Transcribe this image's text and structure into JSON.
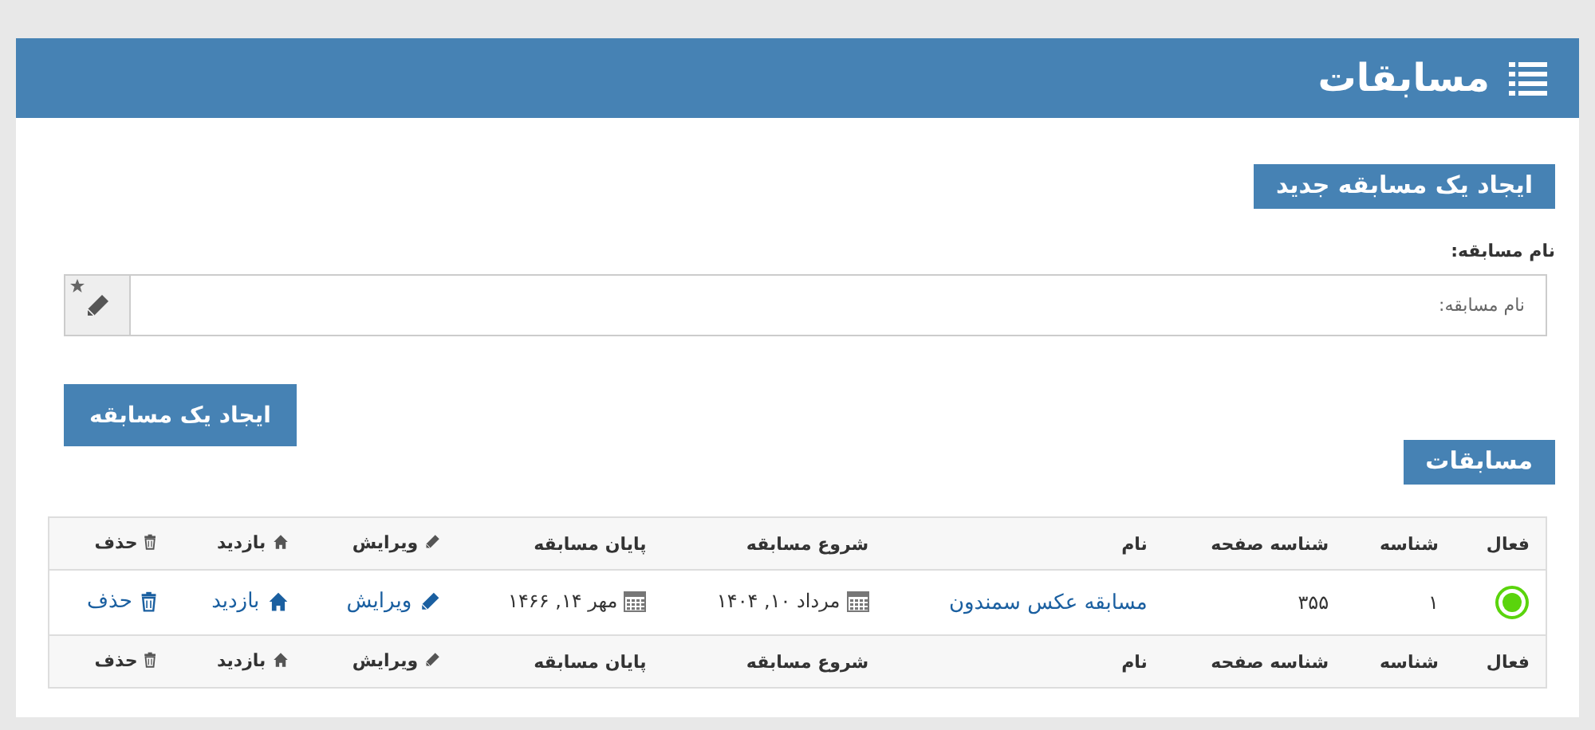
{
  "header": {
    "title": "مسابقات"
  },
  "create_section": {
    "heading": "ایجاد یک مسابقه جدید",
    "field": {
      "label": "نام مسابقه:",
      "placeholder": "نام مسابقه:"
    },
    "button": "ایجاد یک مسابقه"
  },
  "list_section": {
    "heading": "مسابقات",
    "table": {
      "columns": [
        {
          "label": "فعال",
          "kind": "plain"
        },
        {
          "label": "شناسه",
          "kind": "plain"
        },
        {
          "label": "شناسه صفحه",
          "kind": "plain"
        },
        {
          "label": "نام",
          "kind": "plain"
        },
        {
          "label": "شروع مسابقه",
          "kind": "plain"
        },
        {
          "label": "پایان مسابقه",
          "kind": "plain"
        },
        {
          "label": "ویرایش",
          "kind": "edit"
        },
        {
          "label": "بازدید",
          "kind": "visit"
        },
        {
          "label": "حذف",
          "kind": "delete"
        }
      ],
      "rows": [
        {
          "active": true,
          "id": "۱",
          "page_id": "۳۵۵",
          "name": "مسابقه عکس سمندون",
          "start": "مرداد ۱۰, ۱۴۰۴",
          "end": "مهر ۱۴, ۱۴۶۶",
          "edit": "ویرایش",
          "visit": "بازدید",
          "delete": "حذف"
        }
      ],
      "footer_columns": [
        {
          "label": "فعال",
          "kind": "plain"
        },
        {
          "label": "شناسه",
          "kind": "plain"
        },
        {
          "label": "شناسه صفحه",
          "kind": "plain"
        },
        {
          "label": "نام",
          "kind": "plain"
        },
        {
          "label": "شروع مسابقه",
          "kind": "plain"
        },
        {
          "label": "پایان مسابقه",
          "kind": "plain"
        },
        {
          "label": "ویرایش",
          "kind": "edit"
        },
        {
          "label": "بازدید",
          "kind": "visit"
        },
        {
          "label": "حذف",
          "kind": "delete"
        }
      ]
    }
  }
}
